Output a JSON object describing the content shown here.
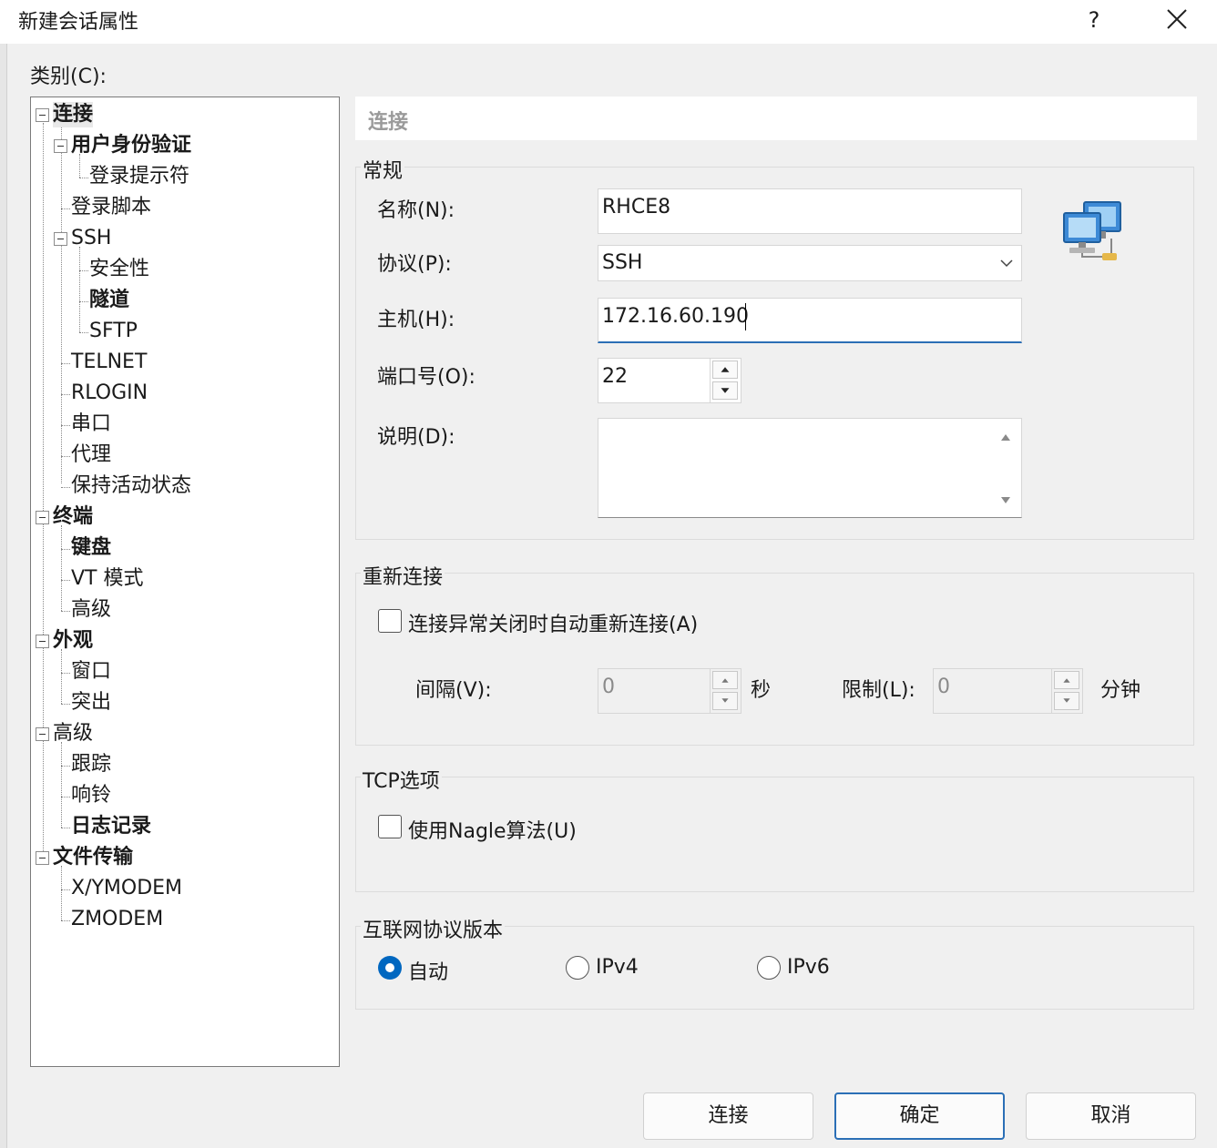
{
  "window": {
    "title": "新建会话属性",
    "help": "?"
  },
  "category_label": "类别(C):",
  "tree": {
    "items": [
      {
        "label": "连接",
        "bold": true
      },
      {
        "label": "用户身份验证",
        "bold": true
      },
      {
        "label": "登录提示符",
        "bold": false
      },
      {
        "label": "登录脚本",
        "bold": false
      },
      {
        "label": "SSH",
        "bold": false
      },
      {
        "label": "安全性",
        "bold": false
      },
      {
        "label": "隧道",
        "bold": true
      },
      {
        "label": "SFTP",
        "bold": false
      },
      {
        "label": "TELNET",
        "bold": false
      },
      {
        "label": "RLOGIN",
        "bold": false
      },
      {
        "label": "串口",
        "bold": false
      },
      {
        "label": "代理",
        "bold": false
      },
      {
        "label": "保持活动状态",
        "bold": false
      },
      {
        "label": "终端",
        "bold": true
      },
      {
        "label": "键盘",
        "bold": true
      },
      {
        "label": "VT 模式",
        "bold": false
      },
      {
        "label": "高级",
        "bold": false
      },
      {
        "label": "外观",
        "bold": true
      },
      {
        "label": "窗口",
        "bold": false
      },
      {
        "label": "突出",
        "bold": false
      },
      {
        "label": "高级",
        "bold": false
      },
      {
        "label": "跟踪",
        "bold": false
      },
      {
        "label": "响铃",
        "bold": false
      },
      {
        "label": "日志记录",
        "bold": true
      },
      {
        "label": "文件传输",
        "bold": true
      },
      {
        "label": "X/YMODEM",
        "bold": false
      },
      {
        "label": "ZMODEM",
        "bold": false
      }
    ]
  },
  "panel": {
    "header": "连接",
    "general": {
      "title": "常规",
      "name_label": "名称(N):",
      "name_value": "RHCE8",
      "protocol_label": "协议(P):",
      "protocol_value": "SSH",
      "host_label": "主机(H):",
      "host_value": "172.16.60.190",
      "port_label": "端口号(O):",
      "port_value": "22",
      "desc_label": "说明(D):",
      "desc_value": ""
    },
    "reconnect": {
      "title": "重新连接",
      "auto_label": "连接异常关闭时自动重新连接(A)",
      "auto_checked": false,
      "interval_label": "间隔(V):",
      "interval_value": "0",
      "interval_unit": "秒",
      "limit_label": "限制(L):",
      "limit_value": "0",
      "limit_unit": "分钟"
    },
    "tcp": {
      "title": "TCP选项",
      "nagle_label": "使用Nagle算法(U)",
      "nagle_checked": false
    },
    "ip": {
      "title": "互联网协议版本",
      "options": [
        "自动",
        "IPv4",
        "IPv6"
      ],
      "selected": "自动"
    }
  },
  "buttons": {
    "connect": "连接",
    "ok": "确定",
    "cancel": "取消"
  },
  "colors": {
    "accent": "#0067c0",
    "focus_border": "#2b6fb6",
    "header_text": "#9a9a9a"
  }
}
